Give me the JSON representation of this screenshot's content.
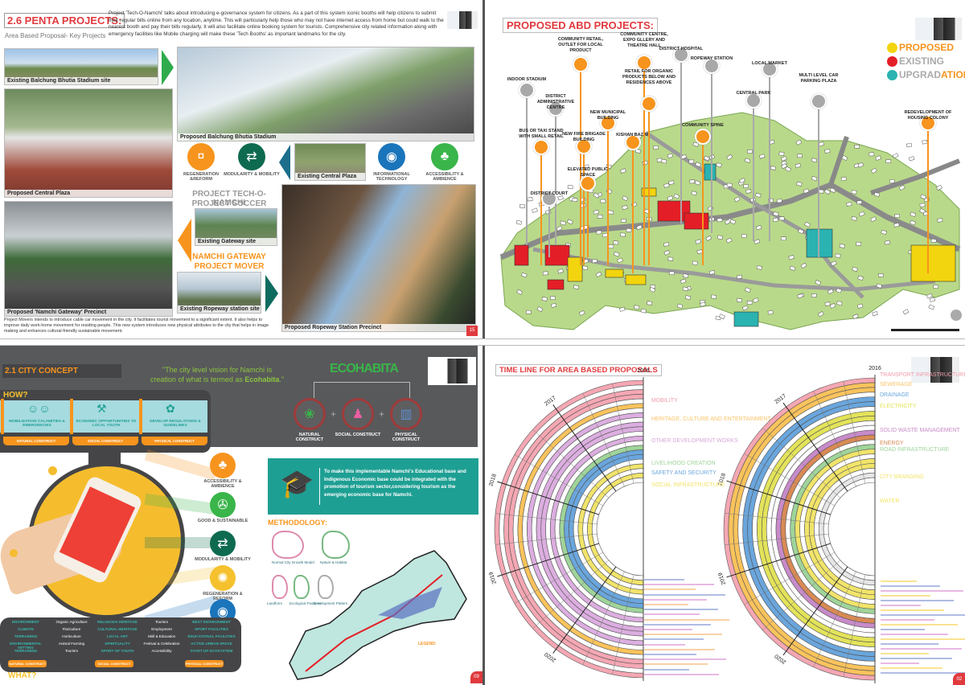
{
  "penta": {
    "title": "2.6 PENTA PROJECTS:",
    "subtitle": "Area Based Proposal- Key Projects",
    "intro": "Project 'Tech-O-Namchi' talks about introducing e-governance system for citizens. As a part of this system iconic booths will help citizens to submit their regular bills online from any location, anytime. This will particularly help those who may not have internet access from home but could walk to the nearest booth and pay their bills regularly. It will also facilitate online booking system for tourists. Comprehensive city related information along with emergency facilities like Mobile charging will make these 'Tech Booths' as important landmarks for the city.",
    "captions": {
      "existing_stadium": "Existing Balchung Bhutia Stadium site",
      "proposed_stadium": "Proposed Balchung Bhutia Stadium",
      "proposed_plaza": "Proposed Central Plaza",
      "existing_plaza": "Existing Central Plaza",
      "proposed_gateway": "Proposed 'Namchi Gateway' Precinct",
      "existing_gateway": "Existing Gateway site",
      "existing_ropeway": "Existing Ropeway station site",
      "proposed_ropeway": "Proposed Ropeway Station Precinct"
    },
    "icons": [
      {
        "label": "REGENERATION &REFORM",
        "icon": "piggy-bank-icon",
        "color": "#f7941d"
      },
      {
        "label": "MODULARITY & MOBILITY",
        "icon": "mobility-icon",
        "color": "#0e6b4f"
      },
      {
        "label": "INFORMATIONAL TECHNOLOGY",
        "icon": "wifi-icon",
        "color": "#1b75bb"
      },
      {
        "label": "ACCESSIBILITY & AMBIENCE",
        "icon": "palm-tree-icon",
        "color": "#39b54a"
      }
    ],
    "project_tech": "PROJECT TECH-O-NAMCHI",
    "project_soccer": "PROJECT SOCCER",
    "namchi_gateway": "NAMCHI GATEWAY",
    "project_mover": "PROJECT MOVER",
    "mover_text": "Project Movers intends to introduce cable car movement in the city. It facilitates tourist movement to a significant extent. It also helps to improve daily work-home movement for residing people. This new system introduces new physical attributes to the city that helps in image making and enhances cultural-friendly sustainable movement.",
    "page": "15"
  },
  "abd": {
    "title": "PROPOSED ABD PROJECTS:",
    "legend": [
      {
        "label": "PROPOSED",
        "color": "#f2d40f"
      },
      {
        "label": "EXISTING",
        "color": "#e41e26"
      },
      {
        "label": "UPGRAD",
        "label2": "ATION",
        "color": "#2ab3b1"
      }
    ],
    "pins": [
      {
        "label": "INDOOR STADIUM",
        "status": "existing"
      },
      {
        "label": "DISTRICT ADMINISTRATIVE CENTRE",
        "status": "existing"
      },
      {
        "label": "BUS OR TAXI STAND WITH SMALL RETAIL",
        "status": "proposed"
      },
      {
        "label": "COMMUNITY RETAIL, OUTLET FOR LOCAL PRODUCT",
        "status": "proposed"
      },
      {
        "label": "NEW FIRE BRIGADE BUILDING",
        "status": "proposed"
      },
      {
        "label": "NEW MUNICIPAL BUILDING",
        "status": "proposed"
      },
      {
        "label": "KISHAN BAZAR",
        "status": "proposed"
      },
      {
        "label": "COMMUNITY CENTRE, EXPO GLLERY AND THEATRE HALL",
        "status": "proposed"
      },
      {
        "label": "RETAIL FOR ORGANIC PRODUCTS BELOW AND RESIDENCES ABOVE",
        "status": "proposed"
      },
      {
        "label": "DISTRICT HOSPITAL",
        "status": "existing"
      },
      {
        "label": "ROPEWAY STATION",
        "status": "existing"
      },
      {
        "label": "COMMUNITY SPINE",
        "status": "proposed"
      },
      {
        "label": "LOCAL MARKET",
        "status": "existing"
      },
      {
        "label": "CENTRAL PARK",
        "status": "existing"
      },
      {
        "label": "MULTI LEVEL CAR PARKING PLAZA",
        "status": "existing"
      },
      {
        "label": "REDEVELOPMENT OF HOUSING COLONY",
        "status": "proposed"
      },
      {
        "label": "ELEVATED PUBLIC SPACE",
        "status": "proposed"
      },
      {
        "label": "DISTRICT COURT",
        "status": "existing"
      }
    ]
  },
  "concept": {
    "title": "2.1 CITY CONCEPT",
    "quote_1": "\"The city level vision for Namchi is",
    "quote_2": "creation of what is termed as ",
    "quote_em": "Ecohabita",
    "quote_end": ".\"",
    "ecohabita": "ECOHABITA",
    "constructs": [
      {
        "label": "NATURAL CONSTRUCT",
        "color": "#39b54a"
      },
      {
        "label": "SOCIAL CONSTRUCT",
        "color": "#ec5fa3"
      },
      {
        "label": "PHYSICAL CONSTRUCT",
        "color": "#5b8fd0"
      }
    ],
    "how": "HOW?",
    "how_items": [
      "MOBILIZATION CALAMITIES & EMERGENCIES",
      "ECONOMIC OPPORTUNITIES TO LOCAL YOUTH",
      "DEVELOP REGULATIONS & GUIDELINES"
    ],
    "how_tabs": [
      "NATURAL CONSTRUCT",
      "SOCIAL CONSTRUCT",
      "PHYSICAL CONSTRUCT"
    ],
    "side_icons": [
      {
        "label": "ACCESSIBILITY & AMBIENCE",
        "color": "#f7941d"
      },
      {
        "label": "GOOD & SUSTAINABLE",
        "color": "#39b54a"
      },
      {
        "label": "MODULARITY & MOBILITY",
        "color": "#0e6b4f"
      },
      {
        "label": "REGENERATION & REFORM",
        "color": "#f5c12e"
      },
      {
        "label": "INFORMATION TECHNOLOGY",
        "color": "#1b75bb"
      }
    ],
    "edu_text": "To make this implementable Namchi's Educational base and Indigenous Economic base could be integrated with the promotion of tourism sector,considering tourism as the emerging economic base for Namchi.",
    "methodology": "METHODOLOGY:",
    "sketches": [
      "Normal City Growth Model",
      "Nature & Habitat",
      "Landform",
      "Ecological Features",
      "Development Pattern"
    ],
    "legend_title": "LEGEND:",
    "what_cols": [
      [
        "ENVIRONMENT",
        "CLIMATE",
        "TERRAINING",
        "ENVIRONMENTAL SETTING",
        "TERRAINING"
      ],
      [
        "Organic Agriculture",
        "Floriculture",
        "Horticulture",
        "Animal Farming",
        "Tourism"
      ],
      [
        "RELIGIOUS HERITAGE",
        "CULTURAL HERITAGE",
        "LOCAL ART",
        "SPIRITUALITY",
        "SPORT OF YOUTH"
      ],
      [
        "Tourism",
        "Employment",
        "Skill & Education",
        "Festival & Celebration",
        "Accessibility"
      ],
      [
        "BEST ENVIRONMENT",
        "SPORT FACILITIES",
        "EDUCATIONAL FACILITIES",
        "ACTIVE URBAN SPACE",
        "START UP ECOSYSTEM"
      ]
    ],
    "what_tabs": [
      "NATURAL CONSTRUCT",
      "SOCIAL CONSTRUCT",
      "PHYSICAL CONSTRUCT"
    ],
    "what": "WHAT?",
    "page": "09"
  },
  "timeline": {
    "title": "TIME LINE FOR AREA BASED PROPOSALS",
    "years": [
      "2016",
      "2017",
      "2018",
      "2019",
      "2020",
      "2021"
    ],
    "fan1_labels": [
      {
        "text": "MOBILITY",
        "color": "#f19cab"
      },
      {
        "text": "HERITAGE, CULTURE AND ENTERTAINMENT",
        "color": "#f8c46a"
      },
      {
        "text": "OTHER DEVELOPMENT WORKS",
        "color": "#d7a8d6"
      },
      {
        "text": "LIVELIHOOD CREATION",
        "color": "#9fd49a"
      },
      {
        "text": "SAFETY AND SECURITY",
        "color": "#6aa6dd"
      },
      {
        "text": "SOCIAL INFRASTRUCTURE",
        "color": "#f1e46a"
      }
    ],
    "fan2_labels": [
      {
        "text": "TRANSPORT INFRASTRUCTURE",
        "color": "#f19cab"
      },
      {
        "text": "SEWERAGE",
        "color": "#f8c46a"
      },
      {
        "text": "DRAINAGE",
        "color": "#6aa6dd"
      },
      {
        "text": "ELECTRICITY",
        "color": "#e3e35a"
      },
      {
        "text": "SOLID WASTE MANAGEMENT",
        "color": "#c78bc9"
      },
      {
        "text": "ENERGY",
        "color": "#d98a55"
      },
      {
        "text": "ROAD INFRASTRUCTURE",
        "color": "#9fd49a"
      },
      {
        "text": "CITY BRANDING",
        "color": "#f1e46a"
      },
      {
        "text": "WATER",
        "color": "#f1e46a"
      }
    ],
    "fan1_rings": [
      "#f4a7b3",
      "#ffffff",
      "#f4a7b3",
      "#f4a7b3",
      "#ffffff",
      "#f9c35c",
      "#ffffff",
      "#dcaee0",
      "#ffffff",
      "#dcaee0",
      "#dcaee0",
      "#ffffff",
      "#dcaee0",
      "#ffffff",
      "#9fd49a",
      "#6aa6dd",
      "#6aa6dd",
      "#ffffff",
      "#f1e46a",
      "#ffffff",
      "#f1e46a",
      "#ffffff"
    ],
    "fan2_rings": [
      "#f4a7b3",
      "#f9c35c",
      "#f9c35c",
      "#ffffff",
      "#6aa6dd",
      "#6aa6dd",
      "#ffffff",
      "#e3e35a",
      "#e3e35a",
      "#ffffff",
      "#ffffff",
      "#c78bc9",
      "#d98a55",
      "#ffffff",
      "#9fd49a",
      "#f1e46a",
      "#ffffff",
      "#f1e46a",
      "#f1e46a",
      "#ffffff",
      "#e6e6e6",
      "#ffffff"
    ],
    "page": "02"
  }
}
